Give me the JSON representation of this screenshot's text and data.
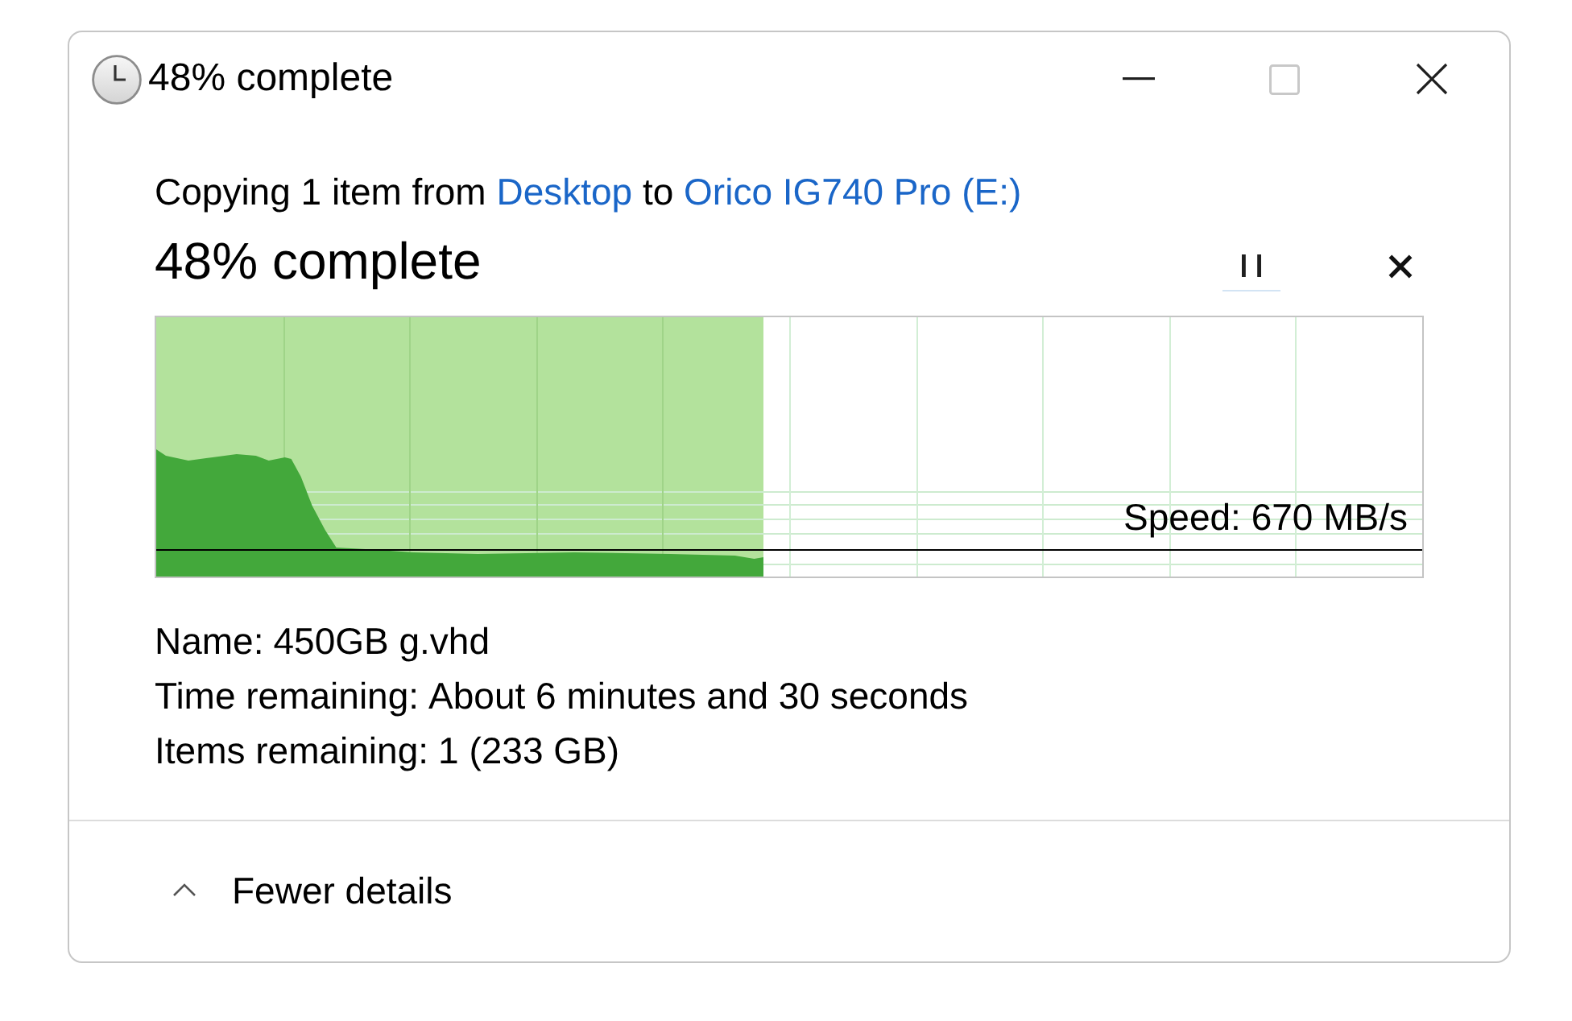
{
  "window": {
    "title": "48% complete",
    "controls": [
      {
        "kind": "minimize",
        "disabled": false
      },
      {
        "kind": "maximize",
        "disabled": true
      },
      {
        "kind": "close",
        "disabled": false
      }
    ]
  },
  "summary": [
    {
      "kind": "text",
      "text": "Copying 1 item from"
    },
    {
      "kind": "link",
      "text": "Desktop"
    },
    {
      "kind": "text",
      "text": "to"
    },
    {
      "kind": "link",
      "text": "Orico IG740 Pro (E:)"
    }
  ],
  "progress": {
    "heading": "48% complete",
    "level": 0.48,
    "speed": "Speed: 670 MB/s",
    "actions": [
      {
        "kind": "pause"
      },
      {
        "kind": "cancel"
      }
    ]
  },
  "details": [
    {
      "label": "Name:",
      "value": "450GB g.vhd"
    },
    {
      "label": "Time remaining:",
      "value": "About 6 minutes and 30 seconds"
    },
    {
      "label": "Items remaining:",
      "value": "1 (233 GB)"
    }
  ],
  "footer": {
    "toggle": "Fewer details",
    "expanded": true
  }
}
